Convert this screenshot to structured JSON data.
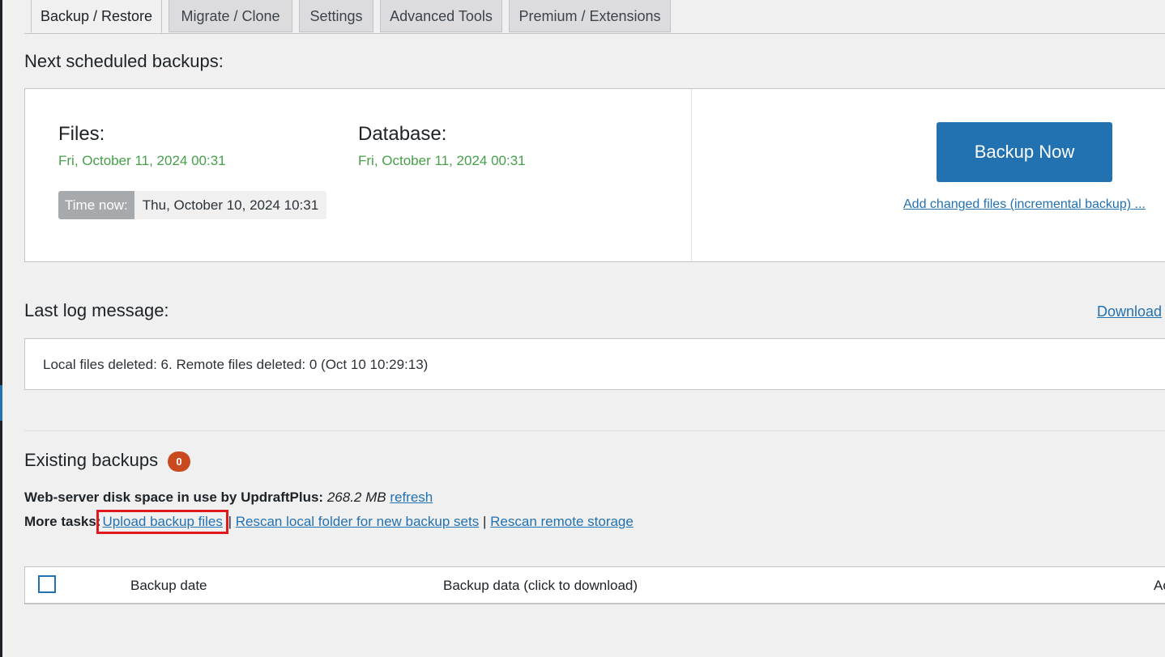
{
  "tabs": [
    {
      "label": "Backup / Restore",
      "active": true
    },
    {
      "label": "Migrate / Clone",
      "active": false
    },
    {
      "label": "Settings",
      "active": false
    },
    {
      "label": "Advanced Tools",
      "active": false
    },
    {
      "label": "Premium / Extensions",
      "active": false
    }
  ],
  "scheduled": {
    "heading": "Next scheduled backups:",
    "files_title": "Files:",
    "files_date": "Fri, October 11, 2024 00:31",
    "database_title": "Database:",
    "database_date": "Fri, October 11, 2024 00:31",
    "time_now_label": "Time now:",
    "time_now_value": "Thu, October 10, 2024 10:31",
    "backup_now_label": "Backup Now",
    "incremental_link": "Add changed files (incremental backup) ..."
  },
  "log": {
    "heading": "Last log message:",
    "download_link": "Download",
    "message": "Local files deleted: 6. Remote files deleted: 0 (Oct 10 10:29:13)"
  },
  "existing": {
    "heading": "Existing backups",
    "count": "0",
    "disk_label": "Web-server disk space in use by UpdraftPlus:",
    "disk_value": "268.2 MB",
    "refresh_link": "refresh",
    "more_tasks_label": "More tasks:",
    "upload_link": "Upload backup files",
    "separator": "|",
    "rescan_local_link": "Rescan local folder for new backup sets",
    "rescan_remote_link": "Rescan remote storage"
  },
  "table": {
    "col_date": "Backup date",
    "col_data": "Backup data (click to download)",
    "col_actions": "Actions"
  },
  "colors": {
    "accent": "#2271b1",
    "date_green": "#46a04a",
    "badge": "#ca4a1f",
    "highlight": "#e0191f"
  }
}
